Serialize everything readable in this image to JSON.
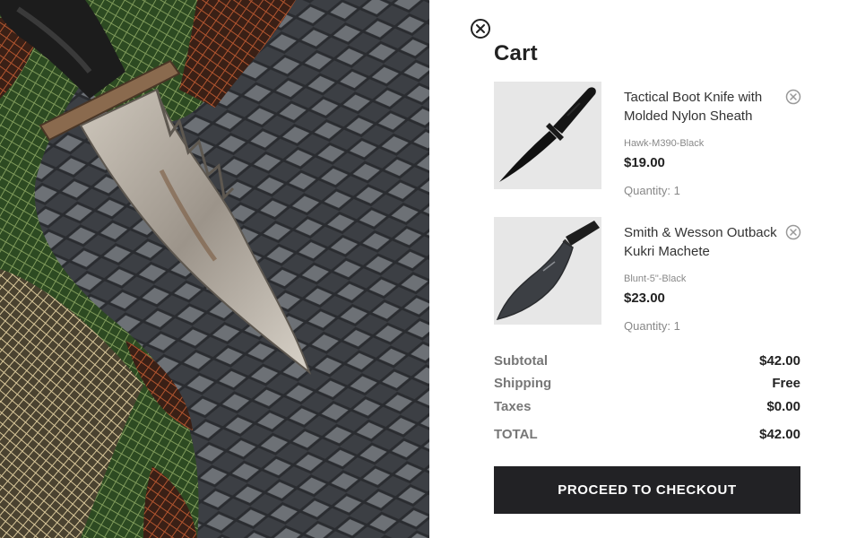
{
  "cart": {
    "title": "Cart",
    "items": [
      {
        "name": "Tactical Boot Knife with Molded Nylon Sheath",
        "sku": "Hawk-M390-Black",
        "price": "$19.00",
        "quantity": "Quantity: 1",
        "thumb_icon": "boot-knife"
      },
      {
        "name": "Smith & Wesson Outback Kukri Machete",
        "sku": "Blunt-5\"-Black",
        "price": "$23.00",
        "quantity": "Quantity: 1",
        "thumb_icon": "kukri-machete"
      }
    ],
    "summary": {
      "subtotal_label": "Subtotal",
      "subtotal_value": "$42.00",
      "shipping_label": "Shipping",
      "shipping_value": "Free",
      "taxes_label": "Taxes",
      "taxes_value": "$0.00",
      "total_label": "TOTAL",
      "total_value": "$42.00"
    },
    "checkout_label": "PROCEED TO CHECKOUT"
  },
  "colors": {
    "button_bg": "#222225",
    "thumb_bg": "#e7e7e7",
    "muted_text": "#888888"
  }
}
